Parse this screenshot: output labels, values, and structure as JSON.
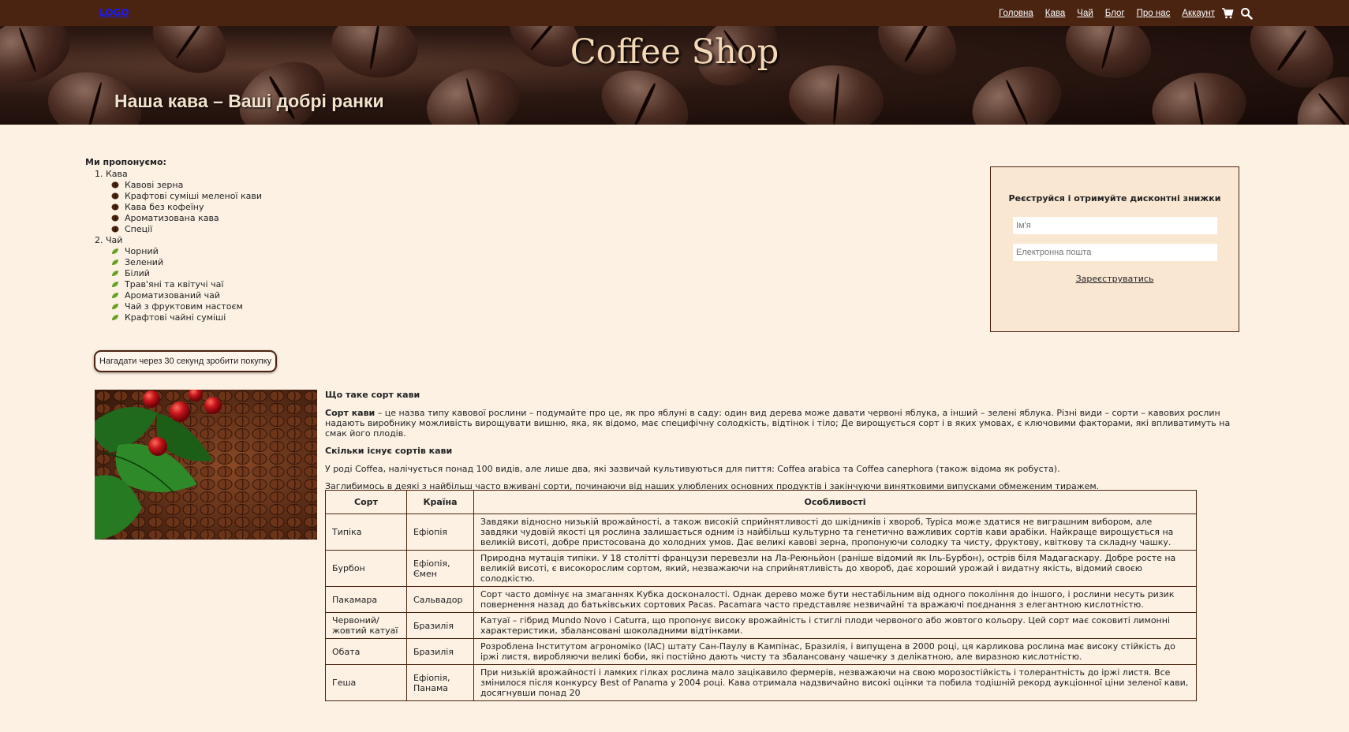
{
  "nav": {
    "logo": "LOGO",
    "links": [
      "Головна",
      "Кава",
      "Чай",
      "Блог",
      "Про нас",
      "Аккаунт"
    ],
    "icons": [
      "cart-icon",
      "search-icon"
    ]
  },
  "hero": {
    "title": "Coffee Shop",
    "subtitle": "Наша кава – Ваші добрі ранки"
  },
  "offer": {
    "title": "Ми пропонуємо:",
    "groups": [
      {
        "label": "1. Кава",
        "items": [
          "Кавові зерна",
          "Крафтові суміші меленої кави",
          "Кава без кофеїну",
          "Ароматизована кава",
          "Спеції"
        ]
      },
      {
        "label": "2. Чай",
        "items": [
          "Чорний",
          "Зелений",
          "Білий",
          "Трав'яні та квітучі чаї",
          "Ароматизований чай",
          "Чай з фруктовим настоєм",
          "Крафтові чайні суміші"
        ]
      }
    ]
  },
  "register": {
    "title": "Реєструйся і отримуйте дисконтні знижки",
    "name_placeholder": "Ім'я",
    "email_placeholder": "Електронна пошта",
    "submit": "Зареєструватись"
  },
  "reminder": {
    "label": "Нагадати через 30 секунд зробити покупку"
  },
  "article": {
    "h1": "Що таке сорт кави",
    "p1_bold": "Сорт кави",
    "p1": " – це назва типу кавової рослини – подумайте про це, як про яблуні в саду: один вид дерева може давати червоні яблука, а інший – зелені яблука. Різні види – сорти – кавових рослин надають виробнику можливість вирощувати вишню, яка, як відомо, має специфічну солодкість, відтінок і тіло; Де вирощується сорт і в яких умовах, є ключовими факторами, які впливатимуть на смак його плодів.",
    "h2": "Скільки існує сортів кави",
    "p2": "У роді Coffea, налічується понад 100 видів, але лише два, які зазвичай культивуються для пиття: Coffea arabica та Coffea canephora (також відома як робуста).",
    "p3": "Заглибимось в деякі з найбільш часто вживані сорти, починаючи від наших улюблених основних продуктів і закінчуючи винятковими випусками обмеженим тиражем."
  },
  "table": {
    "headers": [
      "Сорт",
      "Країна",
      "Особливості"
    ],
    "rows": [
      [
        "Типіка",
        "Ефіопія",
        "Завдяки відносно низькій врожайності, а також високій сприйнятливості до шкідників і хвороб, Typica може здатися не виграшним вибором, але завдяки чудовій якості ця рослина залишається одним із найбільш культурно та генетично важливих сортів кави арабіки. Найкраще вирощується на великій висоті, добре пристосована до холодних умов. Дає великі кавові зерна, пропонуючи солодку та чисту, фруктову, квіткову та складну чашку."
      ],
      [
        "Бурбон",
        "Ефіопія, Ємен",
        "Природна мутація типіки. У 18 столітті французи перевезли на Ла-Реюньйон (раніше відомий як Іль-Бурбон), острів біля Мадагаскару. Добре росте на великій висоті, є високорослим сортом, який, незважаючи на сприйнятливість до хвороб, дає хороший урожай і видатну якість, відомий своєю солодкістю."
      ],
      [
        "Пакамара",
        "Сальвадор",
        "Сорт часто домінує на змаганнях Кубка досконалості. Однак дерево може бути нестабільним від одного покоління до іншого, і рослини несуть ризик повернення назад до батьківських сортових Pacas. Pacamara часто представляє незвичайні та вражаючі поєднання з елегантною кислотністю."
      ],
      [
        "Червоний/ жовтий катуаї",
        "Бразилія",
        "Катуаї – гібрид Mundo Novo і Caturra, що пропонує високу врожайність і стиглі плоди червоного або жовтого кольору. Цей сорт має соковиті лимонні характеристики, збалансовані шоколадними відтінками."
      ],
      [
        "Обата",
        "Бразилія",
        "Розроблена Інститутом агрономіко (IAC) штату Сан-Паулу в Кампінас, Бразилія, і випущена в 2000 році, ця карликова рослина має високу стійкість до іржі листя, виробляючи великі боби, які постійно дають чисту та збалансовану чашечку з делікатною, але виразною кислотністю."
      ],
      [
        "Геша",
        "Ефіопія, Панама",
        "При низькій врожайності і ламких гілках рослина мало зацікавило фермерів, незважаючи на свою морозостійкість і толерантність до іржі листя. Все змінилося після конкурсу Best of Panama у 2004 році. Кава отримала надзвичайно високі оцінки та побила тодішній рекорд аукціонної ціни зеленої кави, досягнувши понад 20"
      ]
    ]
  }
}
